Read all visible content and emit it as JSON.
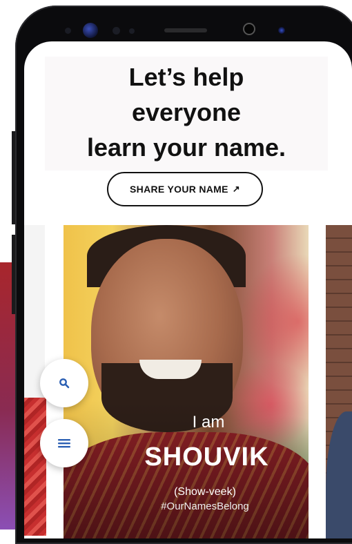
{
  "hero": {
    "line1": "Let’s help",
    "line2": "everyone",
    "line3": "learn your name."
  },
  "cta": {
    "label": "SHARE YOUR NAME",
    "arrow": "↗"
  },
  "card": {
    "intro": "I am",
    "name": "SHOUVIK",
    "pronunciation": "(Show-veek)",
    "hashtag": "#OurNamesBelong"
  },
  "fabs": {
    "search_icon": "search-icon",
    "menu_icon": "hamburger-menu-icon"
  },
  "colors": {
    "fab_icon": "#2b5fb3",
    "text": "#111111"
  }
}
